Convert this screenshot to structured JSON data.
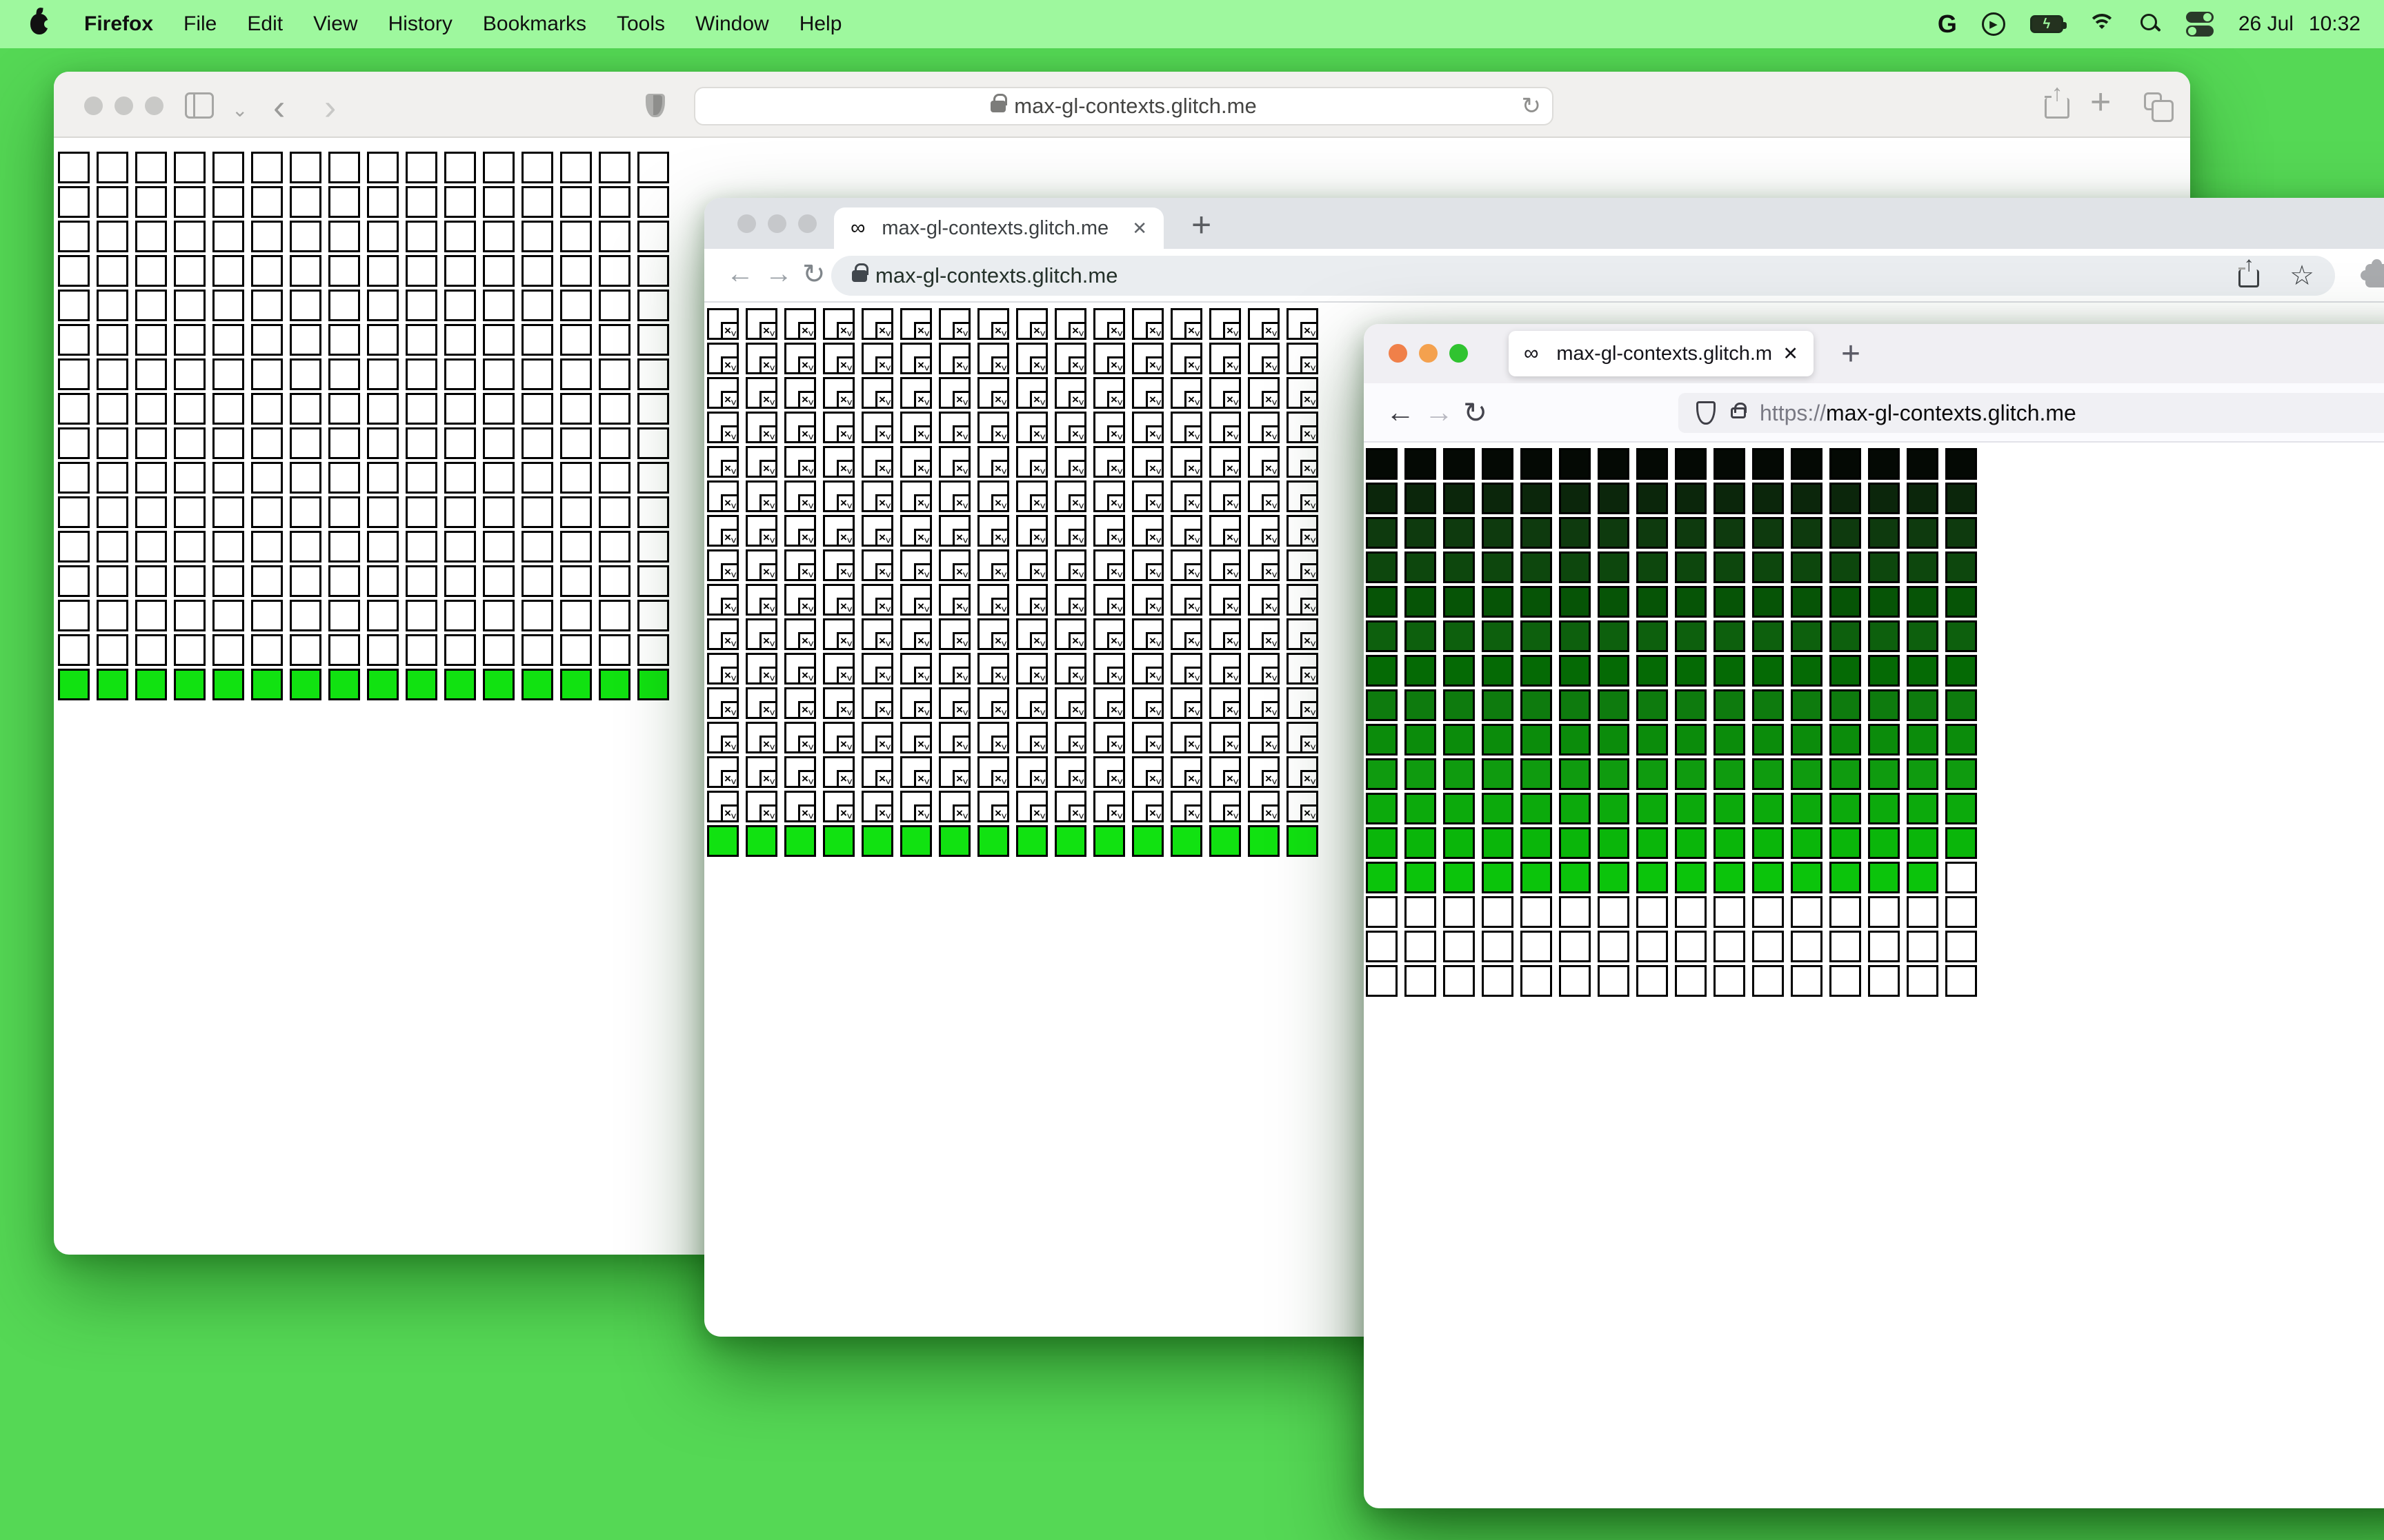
{
  "menu_bar": {
    "app_name": "Firefox",
    "menus": [
      "File",
      "Edit",
      "View",
      "History",
      "Bookmarks",
      "Tools",
      "Window",
      "Help"
    ],
    "status_icons": [
      "google-g",
      "play-circle",
      "battery-charging",
      "wifi",
      "spotlight-search",
      "control-center"
    ],
    "date": "26 Jul",
    "time": "10:32"
  },
  "glyphs": {
    "infinity": "∞",
    "close": "✕",
    "plus": "+",
    "back_arrow": "←",
    "forward_arrow": "→",
    "reload": "↻",
    "back_chevron": "‹",
    "forward_chevron": "›",
    "chevron_down": "⌄",
    "star": "☆",
    "play": "▶",
    "lightning": "ϟ",
    "google_g": "G",
    "broken_x": "×",
    "broken_wave": "˅"
  },
  "safari": {
    "url": "max-gl-contexts.glitch.me",
    "grid": {
      "cols": 16,
      "rows": [
        {
          "fill": "#ffffff",
          "n": 15
        },
        {
          "fill": "#11e211",
          "n": 1
        }
      ]
    }
  },
  "chrome": {
    "tab_title": "max-gl-contexts.glitch.me",
    "url": "max-gl-contexts.glitch.me",
    "grid": {
      "cols": 16,
      "rows": [
        {
          "fill": "#ffffff",
          "n": 15,
          "broken": true
        },
        {
          "fill": "#11e211",
          "n": 1
        }
      ]
    }
  },
  "firefox": {
    "tab_title": "max-gl-contexts.glitch.me/",
    "url_scheme": "https://",
    "url_host": "max-gl-contexts.glitch.me",
    "traffic_light_colors": [
      "#f08049",
      "#f4a14e",
      "#30c330"
    ],
    "grid": {
      "cols": 16,
      "rows": [
        {
          "fill": "#040904"
        },
        {
          "fill": "#0b260b"
        },
        {
          "fill": "#0e3a0e"
        },
        {
          "fill": "#0d470d"
        },
        {
          "fill": "#065406"
        },
        {
          "fill": "#0d600d"
        },
        {
          "fill": "#056a05"
        },
        {
          "fill": "#0e7b0e"
        },
        {
          "fill": "#0b8c0b"
        },
        {
          "fill": "#0f9b0f"
        },
        {
          "fill": "#0caa0c"
        },
        {
          "fill": "#0ab60a"
        },
        {
          "fill": "#0bc40b",
          "overrides": [
            {
              "col": 15,
              "fill": "#ffffff"
            }
          ]
        },
        {
          "fill": "#ffffff",
          "n": 3
        }
      ]
    }
  },
  "colors": {
    "desktop": "#55d855",
    "menubar": "#9ef89e",
    "bright_green_cell": "#11e211",
    "safari_chrome": "#f1f0ee",
    "chrome_tabstrip": "#e0e3e7",
    "firefox_tabbar": "#f0eff3"
  }
}
